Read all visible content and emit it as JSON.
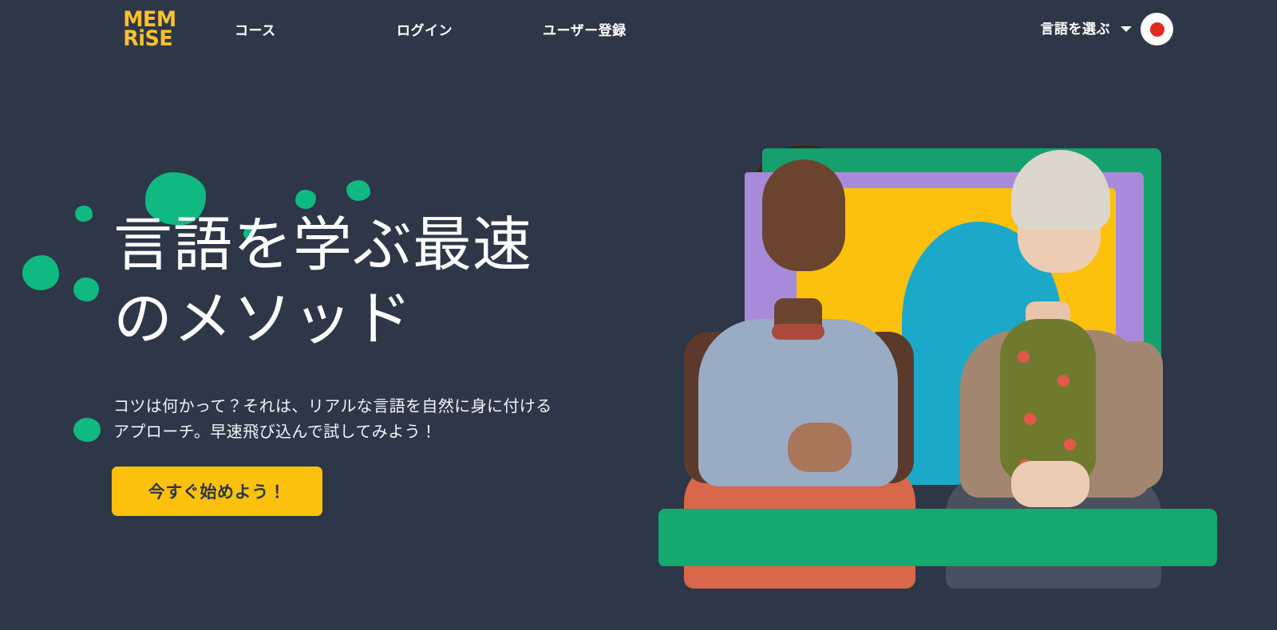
{
  "brand": {
    "logo_line1": "MEM",
    "logo_line2": "RiSE",
    "logo_color": "#fbc02d"
  },
  "nav": {
    "courses": "コース",
    "login": "ログイン",
    "signup": "ユーザー登録",
    "language_picker_label": "言語を選ぶ",
    "chevron_icon": "chevron-down-icon",
    "flag_icon": "japan-flag-icon",
    "flag_white": "#ffffff",
    "flag_red": "#e02b20"
  },
  "hero": {
    "title": "言語を学ぶ最速\nのメソッド",
    "subtitle": "コツは何かって？それは、リアルな言語を自然に身に付ける\nアプローチ。早速飛び込んで試してみよう！",
    "cta_label": "今すぐ始めよう！",
    "cta_bg": "#fcc10d",
    "cta_text_color": "#2d3748"
  },
  "theme": {
    "page_background": "#2d3748",
    "text_primary": "#ffffff",
    "accent_yellow": "#fcc10d",
    "accent_green": "#10b981",
    "accent_purple": "#a78bda",
    "accent_teal": "#1ca8c9"
  },
  "hero_image": {
    "alt": "Two women laughing together seated in front of painted color blocks"
  }
}
